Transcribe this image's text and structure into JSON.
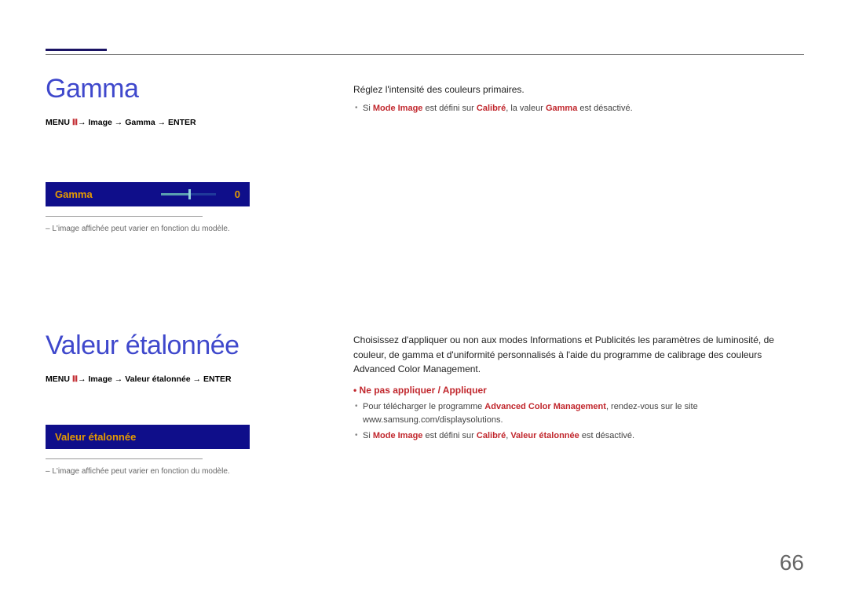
{
  "page_number": "66",
  "section1": {
    "title": "Gamma",
    "menu_path_prefix": "MENU ",
    "menu_path": "→ Image → Gamma → ENTER",
    "bar_label": "Gamma",
    "bar_value": "0",
    "disclaimer": "L'image affichée peut varier en fonction du modèle.",
    "body": "Réglez l'intensité des couleurs primaires.",
    "bullet1_a": "Si ",
    "bullet1_b": "Mode Image",
    "bullet1_c": " est défini sur ",
    "bullet1_d": "Calibré",
    "bullet1_e": ", la valeur ",
    "bullet1_f": "Gamma",
    "bullet1_g": " est désactivé."
  },
  "section2": {
    "title": "Valeur étalonnée",
    "menu_path_prefix": "MENU ",
    "menu_path": "→ Image → Valeur étalonnée → ENTER",
    "bar_label": "Valeur étalonnée",
    "disclaimer": "L'image affichée peut varier en fonction du modèle.",
    "body": "Choisissez d'appliquer ou non aux modes Informations et Publicités les paramètres de luminosité, de couleur, de gamma et d'uniformité personnalisés à l'aide du programme de calibrage des couleurs ",
    "body_accent": "Advanced Color Management",
    "body_end": ".",
    "options": "Ne pas appliquer / Appliquer",
    "bullet1_a": "Pour télécharger le programme ",
    "bullet1_b": "Advanced Color Management",
    "bullet1_c": ", rendez-vous sur le site www.samsung.com/displaysolutions.",
    "bullet2_a": "Si ",
    "bullet2_b": "Mode Image",
    "bullet2_c": " est défini sur ",
    "bullet2_d": "Calibré",
    "bullet2_e": ", ",
    "bullet2_f": "Valeur étalonnée",
    "bullet2_g": " est désactivé."
  }
}
